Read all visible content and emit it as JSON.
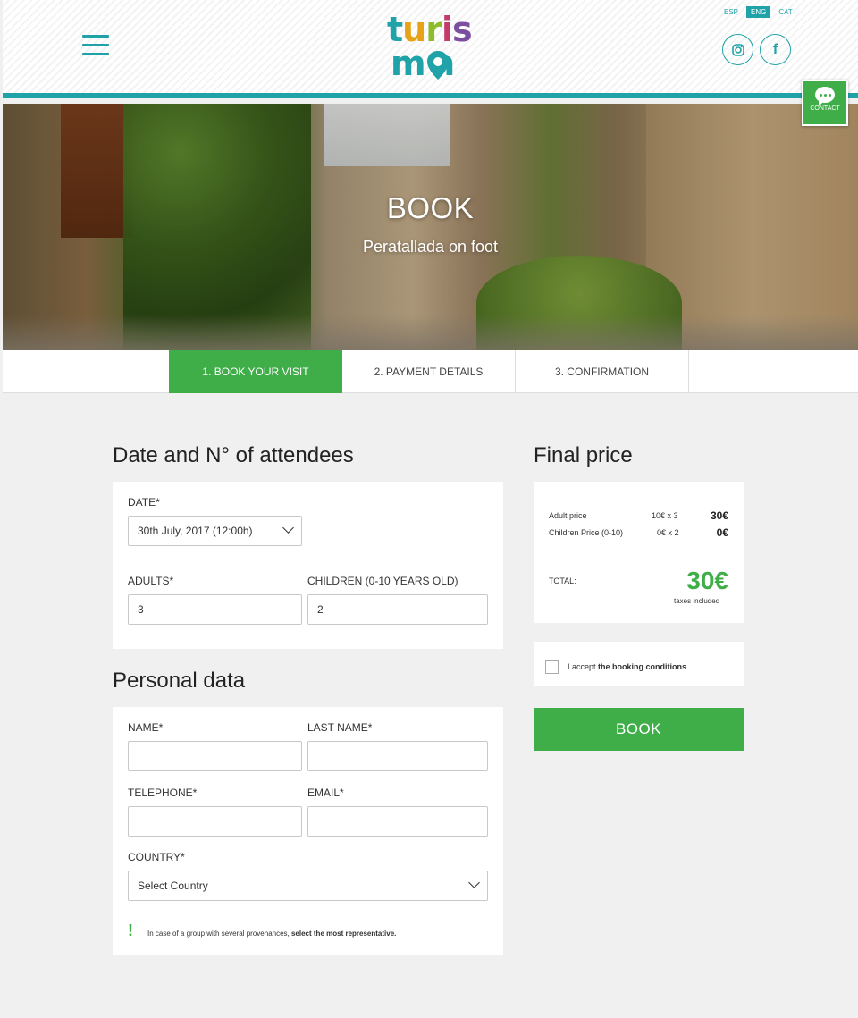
{
  "header": {
    "logo_line1": [
      "t",
      "u",
      "r",
      "i",
      "s"
    ],
    "logo_line2": "m n",
    "languages": [
      "ESP",
      "ENG",
      "CAT"
    ],
    "active_language": "ENG",
    "social": {
      "instagram_icon": "instagram-icon",
      "facebook_glyph": "f"
    }
  },
  "contact": {
    "label": "CONTACT"
  },
  "hero": {
    "title": "BOOK",
    "subtitle": "Peratallada on foot"
  },
  "steps": [
    "1. BOOK YOUR VISIT",
    "2. PAYMENT DETAILS",
    "3. CONFIRMATION"
  ],
  "attendees": {
    "title": "Date and N° of attendees",
    "date_label": "DATE*",
    "date_value": "30th July, 2017 (12:00h)",
    "adults_label": "ADULTS*",
    "adults_value": "3",
    "children_label": "CHILDREN (0-10 YEARS OLD)",
    "children_value": "2"
  },
  "personal": {
    "title": "Personal data",
    "name_label": "NAME*",
    "last_name_label": "LAST NAME*",
    "telephone_label": "TELEPHONE*",
    "email_label": "EMAIL*",
    "country_label": "COUNTRY*",
    "country_value": "Select Country",
    "note_mark": "!",
    "note_text": "In case of a group with several provenances, ",
    "note_bold": "select the most representative."
  },
  "price": {
    "title": "Final price",
    "rows": [
      {
        "label": "Adult price",
        "calc": "10€ x 3",
        "value": "30€"
      },
      {
        "label": "Children Price (0-10)",
        "calc": "0€ x 2",
        "value": "0€"
      }
    ],
    "total_label": "TOTAL:",
    "total_value": "30€",
    "taxes": "taxes included"
  },
  "conditions": {
    "text": "I accept ",
    "link": "the booking conditions"
  },
  "book_button": "BOOK",
  "colors": {
    "teal": "#1fa3a8",
    "green": "#3fae49"
  }
}
